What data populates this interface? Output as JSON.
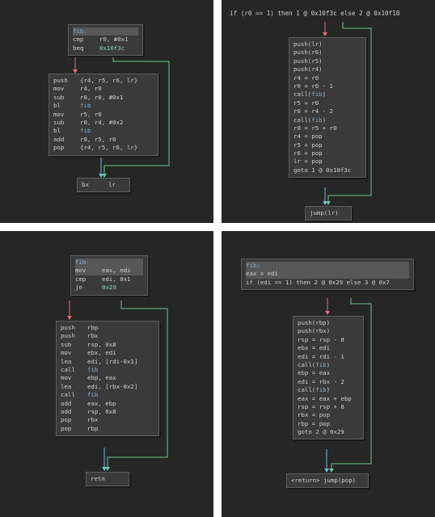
{
  "colors": {
    "panel_bg": "#262626",
    "node_bg": "#3a3a3a",
    "edge_true": "#6fc48b",
    "edge_false": "#e06c7a",
    "edge_flow": "#6fb8d8"
  },
  "panels": {
    "tl": {
      "head": [
        {
          "mn": "fib:",
          "op": "",
          "hl": true,
          "label": true
        },
        {
          "mn": "cmp",
          "op": "r0, #0x1"
        },
        {
          "mn": "beq",
          "op": "0x10f3c"
        }
      ],
      "body": [
        {
          "mn": "push",
          "op": "{r4, r5, r6, lr}"
        },
        {
          "mn": "mov",
          "op": "r4, r0"
        },
        {
          "mn": "sub",
          "op": "r0, r0, #0x1"
        },
        {
          "mn": "bl",
          "op": "fib"
        },
        {
          "mn": "mov",
          "op": "r5, r0"
        },
        {
          "mn": "sub",
          "op": "r0, r4, #0x2"
        },
        {
          "mn": "bl",
          "op": "fib"
        },
        {
          "mn": "add",
          "op": "r0, r5, r0"
        },
        {
          "mn": "pop",
          "op": "{r4, r5, r6, lr}"
        }
      ],
      "tail": [
        {
          "mn": "bx",
          "op": "lr"
        }
      ]
    },
    "tr": {
      "cond": "if (r0 == 1) then 1 @ 0x10f3c else 2 @ 0x10f18",
      "body": [
        "push(lr)",
        "push(r6)",
        "push(r5)",
        "push(r4)",
        "r4 = r0",
        "r0 = r0 - 1",
        "call(fib)",
        "r5 = r0",
        "r0 = r4 - 2",
        "call(fib)",
        "r0 = r5 + r0",
        "r4 = pop",
        "r5 = pop",
        "r6 = pop",
        "lr = pop",
        "goto 1 @ 0x10f3c"
      ],
      "tail": [
        "jump(lr)"
      ]
    },
    "bl": {
      "head": [
        {
          "mn": "fib:",
          "op": "",
          "hl": true,
          "label": true
        },
        {
          "mn": "mov",
          "op": "eax, edi",
          "hl": true
        },
        {
          "mn": "cmp",
          "op": "edi, 0x1"
        },
        {
          "mn": "je",
          "op": "0x29"
        }
      ],
      "body": [
        {
          "mn": "push",
          "op": "rbp"
        },
        {
          "mn": "push",
          "op": "rbx"
        },
        {
          "mn": "sub",
          "op": "rsp, 0x8"
        },
        {
          "mn": "mov",
          "op": "ebx, edi"
        },
        {
          "mn": "lea",
          "op": "edi, [rdi-0x1]"
        },
        {
          "mn": "call",
          "op": "fib"
        },
        {
          "mn": "mov",
          "op": "ebp, eax"
        },
        {
          "mn": "lea",
          "op": "edi, [rbx-0x2]"
        },
        {
          "mn": "call",
          "op": "fib"
        },
        {
          "mn": "add",
          "op": "eax, ebp"
        },
        {
          "mn": "add",
          "op": "rsp, 0x8"
        },
        {
          "mn": "pop",
          "op": "rbx"
        },
        {
          "mn": "pop",
          "op": "rbp"
        }
      ],
      "tail": [
        {
          "mn": "retn",
          "op": ""
        }
      ]
    },
    "br": {
      "head": [
        {
          "text": "fib:",
          "hl": true,
          "label": true
        },
        {
          "text": "eax = edi",
          "hl": true
        },
        {
          "text": "if (edi == 1) then 2 @ 0x29 else 3 @ 0x7"
        }
      ],
      "body": [
        "push(rbp)",
        "push(rbx)",
        "rsp = rsp - 8",
        "ebx = edi",
        "edi = rdi - 1",
        "call(fib)",
        "ebp = eax",
        "edi = rbx - 2",
        "call(fib)",
        "eax = eax + ebp",
        "rsp = rsp + 8",
        "rbx = pop",
        "rbp = pop",
        "goto 2 @ 0x29"
      ],
      "tail": [
        "<return> jump(pop)"
      ]
    }
  }
}
